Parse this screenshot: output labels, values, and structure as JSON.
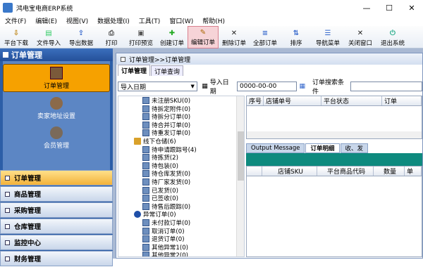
{
  "window": {
    "title": "鸿电宝电商ERP系统"
  },
  "menu": [
    "文件(F)",
    "编辑(E)",
    "视图(V)",
    "数据处理(I)",
    "工具(T)",
    "窗口(W)",
    "帮助(H)"
  ],
  "toolbar": [
    {
      "label": "平台下载",
      "icon": "download-icon"
    },
    {
      "label": "文件导入",
      "icon": "file-import-icon"
    },
    {
      "label": "导出数据",
      "icon": "export-icon"
    },
    {
      "label": "打印",
      "icon": "print-icon"
    },
    {
      "label": "打印预览",
      "icon": "print-preview-icon"
    },
    {
      "label": "创建订单",
      "icon": "plus-icon"
    },
    {
      "label": "编辑订单",
      "icon": "edit-icon"
    },
    {
      "label": "删除订单",
      "icon": "delete-icon"
    },
    {
      "label": "全部订单",
      "icon": "all-orders-icon"
    },
    {
      "label": "排序",
      "icon": "sort-icon"
    },
    {
      "label": "导航菜单",
      "icon": "nav-menu-icon"
    },
    {
      "label": "关闭窗口",
      "icon": "close-window-icon"
    },
    {
      "label": "退出系统",
      "icon": "exit-icon"
    }
  ],
  "sidebar": {
    "header": "订单管理",
    "nav": [
      "订单管理",
      "卖家地址设置",
      "会员管理"
    ],
    "categories": [
      "订单管理",
      "商品管理",
      "采购管理",
      "仓库管理",
      "监控中心",
      "财务管理"
    ]
  },
  "panel": {
    "title": "订单管理>>订单管理",
    "tabs": [
      "订单管理",
      "订单查询"
    ],
    "filter": {
      "select": "导入日期",
      "date_label": "导入日期",
      "date_value": "0000-00-00",
      "search_label": "订单搜索条件"
    }
  },
  "tree": [
    {
      "label": "未注册SKU(0)",
      "level": 2
    },
    {
      "label": "待拆定附件(0)",
      "level": 2
    },
    {
      "label": "待拆分订单(0)",
      "level": 2
    },
    {
      "label": "待合并订单(0)",
      "level": 2
    },
    {
      "label": "待重发订单(0)",
      "level": 2
    },
    {
      "label": "线下仓储(6)",
      "level": 1
    },
    {
      "label": "待申请跟踪号(4)",
      "level": 2
    },
    {
      "label": "待拣货(2)",
      "level": 2
    },
    {
      "label": "待包装(0)",
      "level": 2
    },
    {
      "label": "待仓库发货(0)",
      "level": 2
    },
    {
      "label": "待厂家发货(0)",
      "level": 2
    },
    {
      "label": "已发货(0)",
      "level": 2
    },
    {
      "label": "已签收(0)",
      "level": 2
    },
    {
      "label": "待售后跟踪(0)",
      "level": 2
    },
    {
      "label": "异常订单(0)",
      "level": 1
    },
    {
      "label": "未付款订单(0)",
      "level": 2
    },
    {
      "label": "取消订单(0)",
      "level": 2
    },
    {
      "label": "退货订单(0)",
      "level": 2
    },
    {
      "label": "其他异常1(0)",
      "level": 2
    },
    {
      "label": "其他异常2(0)",
      "level": 2
    }
  ],
  "grid1": {
    "columns": [
      "序号",
      "店铺单号",
      "平台状态",
      "订单"
    ]
  },
  "detail_tabs": [
    "Output Message",
    "订单明细",
    "收、发"
  ],
  "grid2": {
    "columns": [
      "店铺SKU",
      "平台商品代码",
      "数量",
      "单"
    ]
  }
}
